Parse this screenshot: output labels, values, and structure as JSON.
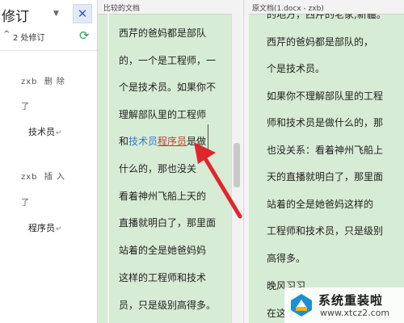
{
  "revision_pane": {
    "title": "修订",
    "close_glyph": "✕",
    "summary": "2 处修订",
    "revisions": [
      {
        "author": "zxb",
        "action": "删 除",
        "le": "了",
        "text": "技术员"
      },
      {
        "author": "zxb",
        "action": "插 入",
        "le": "了",
        "text": "程序员"
      }
    ],
    "para_mark": "↵"
  },
  "compared_doc": {
    "header": "比较的文档",
    "lines": [
      "西芹的爸妈都是部队",
      "的，一个是工程师，一",
      "个是技术员。如果你不",
      "理解部队里的工程师"
    ],
    "highlight_line": {
      "pre": "和",
      "deleted": "技术员",
      "inserted": "程序员",
      "post": "是做"
    },
    "lines_after": [
      "什么的，那也没关",
      "看着神州飞船上天的",
      "直播就明白了，那里面",
      "站着的全是她爸妈妈",
      "这样的工程师和技术",
      "员，只是级别高得多。"
    ]
  },
  "original_doc": {
    "header": "原文档(1.docx - zxb)",
    "top_partial": "的地方，西芹的老家,新疆。",
    "lines": [
      "西芹的爸妈都是部队的，",
      "一个是工程师，一",
      "个是技术员。",
      "如果你不理解部队里的工程",
      "师和技术员是做什么的，那",
      "也没关系：看着神州飞船上",
      "天的直播就明白了，那里面",
      "站着的全是她爸妈这样的",
      "工程师和技术员，只是级别",
      "高得多。",
      "晚风习习",
      "在这个"
    ]
  },
  "watermark": {
    "title": "系统重装啦",
    "url": "www.xtcz2.com"
  },
  "colors": {
    "doc_bg": "#d6ecd4",
    "deleted_text": "#3a78c9",
    "inserted_text": "#d23a2a",
    "arrow": "#e0262d",
    "accent": "#2f5fb3"
  }
}
